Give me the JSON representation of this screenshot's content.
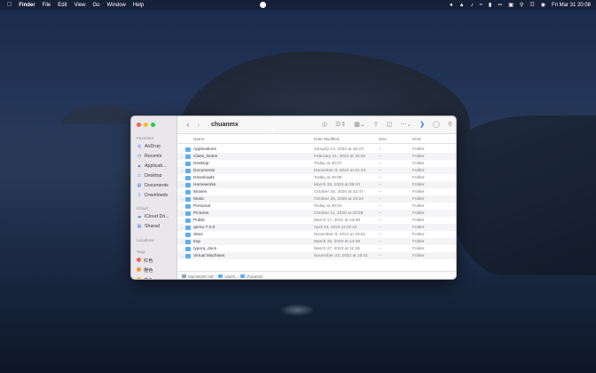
{
  "menubar": {
    "app_name": "Finder",
    "menus": [
      "File",
      "Edit",
      "View",
      "Go",
      "Window",
      "Help"
    ],
    "clock": "Fri Mar 31  20:08"
  },
  "window": {
    "title": "chuanmx",
    "sidebar": {
      "favorites_label": "Favorites",
      "favorites": [
        "AirDrop",
        "Recents",
        "Applicati...",
        "Desktop",
        "Documents",
        "Downloads"
      ],
      "icloud_label": "iCloud",
      "icloud": [
        "iCloud Dri...",
        "Shared"
      ],
      "locations_label": "Locations",
      "tags_label": "Tags",
      "tags": [
        {
          "label": "红色",
          "color": "#fe5f57"
        },
        {
          "label": "橙色",
          "color": "#f79b2c"
        },
        {
          "label": "黄色",
          "color": "#f5c431"
        }
      ]
    },
    "columns": {
      "name": "Name",
      "date": "Date Modified",
      "size": "Size",
      "kind": "Kind"
    },
    "rows": [
      {
        "name": "Applications",
        "date": "January 14, 2022 at 15:23",
        "size": "--",
        "kind": "Folder"
      },
      {
        "name": "Class_Notes",
        "date": "February 21, 2023 at 15:26",
        "size": "--",
        "kind": "Folder"
      },
      {
        "name": "Desktop",
        "date": "Today at 20:07",
        "size": "--",
        "kind": "Folder"
      },
      {
        "name": "Documents",
        "date": "December 8, 2022 at 01:43",
        "size": "--",
        "kind": "Folder"
      },
      {
        "name": "Downloads",
        "date": "Today at 20:06",
        "size": "--",
        "kind": "Folder"
      },
      {
        "name": "Homeworks",
        "date": "March 28, 2023 at 08:10",
        "size": "--",
        "kind": "Folder"
      },
      {
        "name": "Movies",
        "date": "October 25, 2020 at 22:47",
        "size": "--",
        "kind": "Folder"
      },
      {
        "name": "Music",
        "date": "October 25, 2020 at 23:24",
        "size": "--",
        "kind": "Folder"
      },
      {
        "name": "Personal",
        "date": "Today at 20:04",
        "size": "--",
        "kind": "Folder"
      },
      {
        "name": "Pictures",
        "date": "October 11, 2020 at 20:59",
        "size": "--",
        "kind": "Folder"
      },
      {
        "name": "Public",
        "date": "March 17, 2021 at 13:08",
        "size": "--",
        "kind": "Folder"
      },
      {
        "name": "qemu-7.0.0",
        "date": "April 20, 2022 at 03:10",
        "size": "--",
        "kind": "Folder"
      },
      {
        "name": "Sites",
        "date": "November 9, 2021 at 20:51",
        "size": "--",
        "kind": "Folder"
      },
      {
        "name": "tmp",
        "date": "March 28, 2023 at 14:28",
        "size": "--",
        "kind": "Folder"
      },
      {
        "name": "typora_docs",
        "date": "March 27, 2023 at 11:39",
        "size": "--",
        "kind": "Folder"
      },
      {
        "name": "Virtual Machines",
        "date": "November 23, 2022 at 16:01",
        "size": "--",
        "kind": "Folder"
      }
    ],
    "pathbar": [
      "Macintosh HD",
      "Users",
      "chuanmx"
    ]
  },
  "icons": {
    "apple": "apple-icon",
    "sidebar": [
      "airdrop-icon",
      "clock-icon",
      "applications-icon",
      "desktop-icon",
      "document-icon",
      "download-icon",
      "icloud-icon",
      "shared-icon"
    ]
  }
}
